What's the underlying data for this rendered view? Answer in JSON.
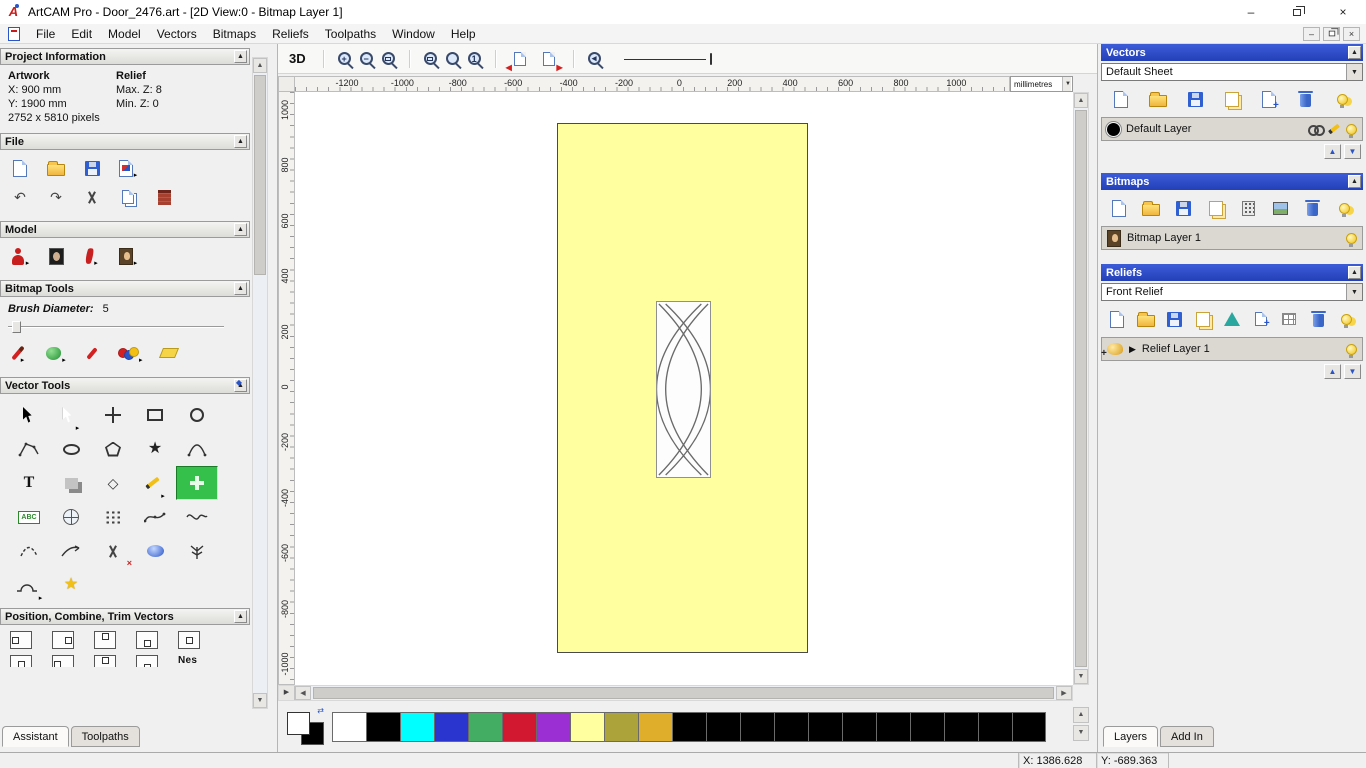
{
  "window": {
    "title": "ArtCAM Pro - Door_2476.art - [2D View:0 - Bitmap Layer 1]"
  },
  "menu": {
    "items": [
      "File",
      "Edit",
      "Model",
      "Vectors",
      "Bitmaps",
      "Reliefs",
      "Toolpaths",
      "Window",
      "Help"
    ]
  },
  "assistant_panel": {
    "project_information": {
      "title": "Project Information",
      "artwork_label": "Artwork",
      "artwork_x": "X: 900 mm",
      "artwork_y": "Y: 1900 mm",
      "relief_label": "Relief",
      "relief_max_z": "Max. Z: 8",
      "relief_min_z": "Min. Z: 0",
      "pixels": "2752 x 5810 pixels"
    },
    "file_title": "File",
    "model_title": "Model",
    "bitmap_tools_title": "Bitmap Tools",
    "brush_diameter_label": "Brush Diameter:",
    "brush_diameter_value": "5",
    "vector_tools_title": "Vector Tools",
    "position_title": "Position, Combine, Trim Vectors",
    "nesting_label": "Nes",
    "tabs": {
      "assistant": "Assistant",
      "toolpaths": "Toolpaths"
    }
  },
  "icons": {
    "text_tool_glyph": "T",
    "text_abc_glyph": "ABC"
  },
  "view": {
    "toolbar_3d_label": "3D",
    "ruler_units": "millimetres",
    "h_ruler_labels": [
      "-1200",
      "-1000",
      "-800",
      "-600",
      "-400",
      "-200",
      "0",
      "200",
      "400",
      "600",
      "800",
      "1000"
    ],
    "v_ruler_labels": [
      "1000",
      "800",
      "600",
      "400",
      "200",
      "0",
      "-200",
      "-400",
      "-600",
      "-800",
      "-1000"
    ]
  },
  "layers_panel": {
    "vectors": {
      "title": "Vectors",
      "sheet": "Default Sheet",
      "layer": "Default Layer"
    },
    "bitmaps": {
      "title": "Bitmaps",
      "layer": "Bitmap Layer 1"
    },
    "reliefs": {
      "title": "Reliefs",
      "relief": "Front Relief",
      "layer": "Relief Layer 1"
    },
    "tabs": {
      "layers": "Layers",
      "add_in": "Add In"
    }
  },
  "palette": {
    "colors": [
      "#ffffff",
      "#000000",
      "#00ffff",
      "#2a34cf",
      "#43ad63",
      "#d21731",
      "#9c2fd4",
      "#ffffa0",
      "#ada33b",
      "#dfaf2c",
      "#000000",
      "#000000",
      "#000000",
      "#000000",
      "#000000",
      "#000000",
      "#000000",
      "#000000",
      "#000000",
      "#000000",
      "#000000"
    ]
  },
  "status_bar": {
    "x": "X: 1386.628",
    "y": "Y: -689.363"
  }
}
